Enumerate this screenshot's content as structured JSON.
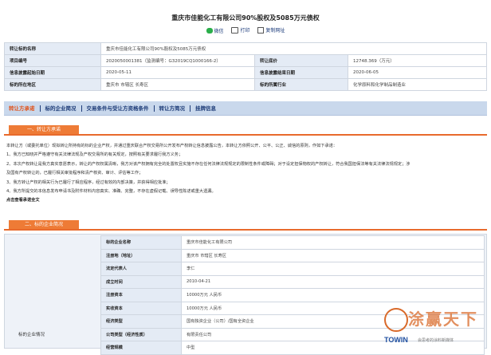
{
  "page_title": "重庆市佳能化工有限公司90%股权及5085万元债权",
  "actions": [
    {
      "label": "微信",
      "icon": "wechat-icon"
    },
    {
      "label": "打印",
      "icon": "print-icon"
    },
    {
      "label": "复制网址",
      "icon": "copy-icon"
    }
  ],
  "info": {
    "subject_label": "转让标的名称",
    "subject_value": "重庆市佳能化工有限公司90%股权及5085万元债权",
    "code_label": "项目编号",
    "code_value": "2020050001381（监测编号：G32019CQ1000166-2）",
    "price_label": "转让底价",
    "price_value": "12748.369（万元）",
    "start_label": "信息披露起始日期",
    "start_value": "2020-05-11",
    "end_label": "信息披露结束日期",
    "end_value": "2020-06-05",
    "region_label": "标的所在地区",
    "region_value": "重庆市 市辖区 长寿区",
    "industry_label": "标的所属行业",
    "industry_value": "化学原料和化学制品制造业"
  },
  "tabs": [
    "转让方承诺",
    "标的企业简况",
    "交易条件与受让方资格条件",
    "转让方简况",
    "挂牌信息"
  ],
  "section1": {
    "title": "一、转让方承诺",
    "lines": [
      "本转让方（或委托单位）现拟转让所持有的标的企业产权，并通过重庆联合产权交易所公开发布产权转让信息披露公告，本转让方依照公开、公平、公正、诚信的原则，作如下承诺：",
      "1、我方已知晓并严格遵守有关法律法规及产权交易所的有关规定，按照有关要求履行我方义务；",
      "2、本次产权转让是我方真实意愿表示，转让的产权权属清晰，我方对该产权拥有完全的处置权且实施不存在任何法律法规规定的限制性条件或障碍；对于设定担保物权的产权转让，符合我国担保法等有关法律法规规定；涉",
      "及国有产权转让的，已履行相关审批程序和清产核资、审计、评估等工作；",
      "3、我方转让产权的相关行为已履行了相应程序，经过有效的内部决策，并获得相应批准；",
      "4、我方所提交的本信息发布申请书及附件材料内容真实、准确、完整，不存在虚假记载、误导性陈述或重大遗漏。"
    ],
    "footer": "点击查看承诺全文"
  },
  "section2": {
    "title": "二、标的企业简况",
    "left_label": "标的企业情况",
    "rows": [
      {
        "label": "标的企业名称",
        "value": "重庆市佳能化工有限公司"
      },
      {
        "label": "注册地（地址）",
        "value": "重庆市 市辖区 长寿区"
      },
      {
        "label": "法定代表人",
        "value": "李仁"
      },
      {
        "label": "成立时间",
        "value": "2010-04-21"
      },
      {
        "label": "注册资本",
        "value": "10000万元 人民币"
      },
      {
        "label": "实收资本",
        "value": "10000万元 人民币"
      },
      {
        "label": "经济类型",
        "value": "国有独资企业（公司）/国有全资企业"
      },
      {
        "label": "公司类型（经济性质）",
        "value": "有限责任公司"
      },
      {
        "label": "经营规模",
        "value": "中型"
      }
    ]
  },
  "watermark": {
    "big_text": "涂赢天下",
    "brand": "TOWIN",
    "sub": "会思考的涂料新媒体"
  },
  "colors": {
    "accent": "#ee7b36",
    "tab_text": "#1e3c78",
    "label_bg": "#e4ebf5"
  }
}
